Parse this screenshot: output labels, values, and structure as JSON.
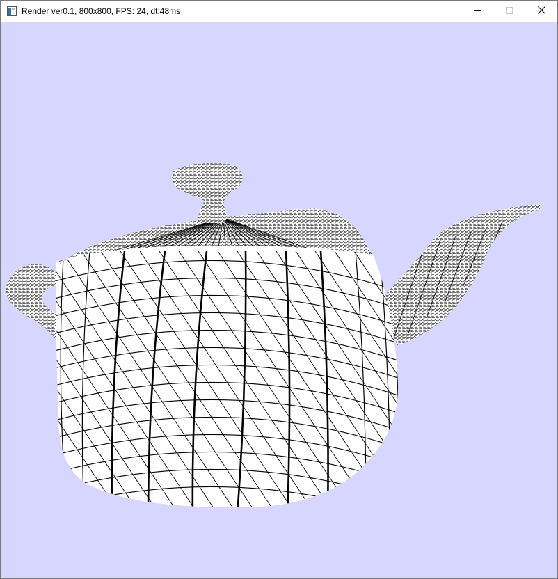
{
  "window": {
    "title": "Render ver0.1, 800x800, FPS:  24, dt:48ms",
    "icon": "app-window-icon",
    "controls": [
      "minimize-icon",
      "maximize-icon",
      "close-icon"
    ]
  },
  "viewport": {
    "background": "#d6d6ff",
    "model_fill": "#ffffff",
    "wire_color": "#000000",
    "scene": "wireframe teapot"
  }
}
